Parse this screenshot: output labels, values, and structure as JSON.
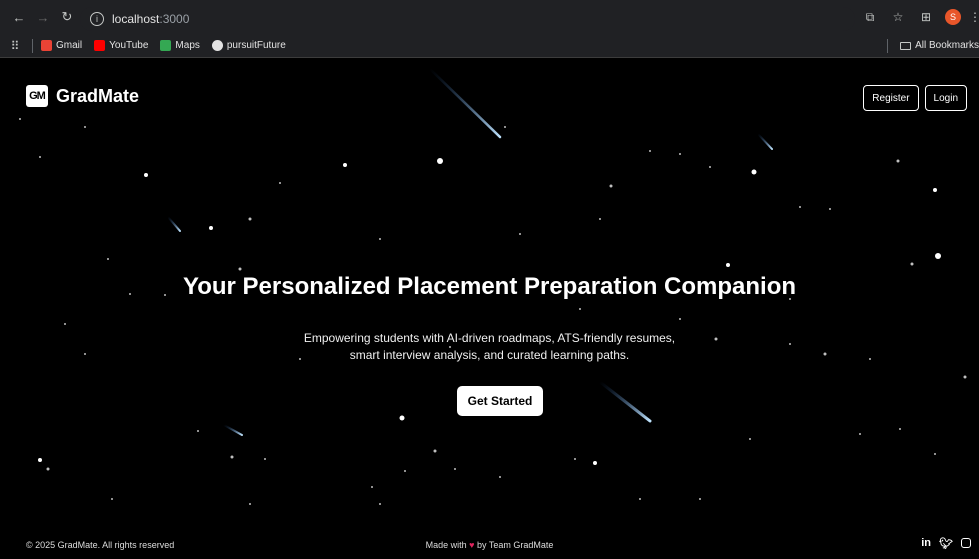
{
  "browser": {
    "url_host": "localhost",
    "url_port": ":3000",
    "profile_initial": "S",
    "bookmarks": [
      {
        "label": "Gmail",
        "color": "#ea4335"
      },
      {
        "label": "YouTube",
        "color": "#ff0000"
      },
      {
        "label": "Maps",
        "color": "#34a853"
      },
      {
        "label": "pursuitFuture",
        "color": "#e3e3e3"
      }
    ],
    "all_bookmarks": "All Bookmarks"
  },
  "header": {
    "logo_mark": "GM",
    "logo_text": "GradMate",
    "register": "Register",
    "login": "Login"
  },
  "hero": {
    "title": "Your Personalized Placement Preparation Companion",
    "subtitle_line1": "Empowering students with AI-driven roadmaps, ATS-friendly resumes,",
    "subtitle_line2": "smart interview analysis, and curated learning paths.",
    "cta": "Get Started"
  },
  "footer": {
    "copyright": "© 2025 GradMate. All rights reserved",
    "made_with_prefix": "Made with",
    "made_with_suffix": "by Team GradMate",
    "socials": [
      "linkedin-icon",
      "twitter-icon",
      "instagram-icon"
    ]
  },
  "colors": {
    "background": "#000000",
    "chrome": "#202124",
    "heart": "#e0245e"
  }
}
